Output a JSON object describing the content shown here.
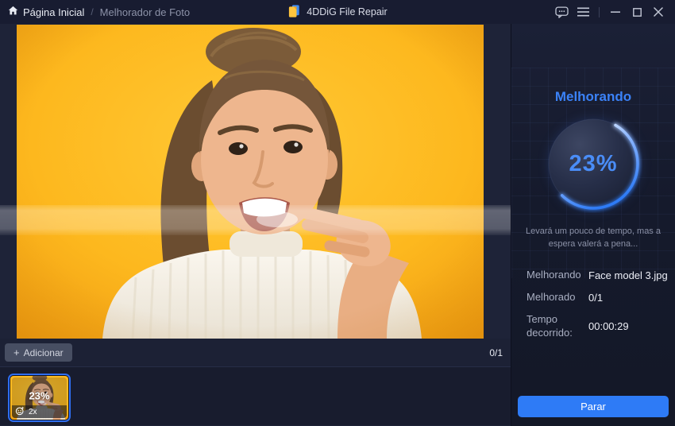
{
  "titlebar": {
    "breadcrumb": {
      "home_label": "Página Inicial",
      "separator": "/",
      "current_label": "Melhorador de Foto"
    },
    "app_title": "4DDiG File Repair"
  },
  "workspace": {
    "add_plus": "+",
    "add_label": "Adicionar",
    "counter": "0/1",
    "thumbnail": {
      "percent_label": "23%",
      "zoom_label": "2x",
      "selected": true
    }
  },
  "progress": {
    "title": "Melhorando",
    "percent_label": "23%",
    "percent_value": 23,
    "caption": "Levará um pouco de tempo, mas a espera valerá a pena...",
    "details": [
      {
        "label": "Melhorando",
        "value": "Face model 3.jpg"
      },
      {
        "label": "Melhorado",
        "value": "0/1"
      },
      {
        "label": "Tempo decorrido:",
        "value": "00:00:29"
      }
    ],
    "stop_label": "Parar"
  },
  "icons": {
    "home": "home-icon",
    "app_logo": "app-logo-icon",
    "feedback": "feedback-bubble-icon",
    "menu": "hamburger-menu-icon",
    "minimize": "minimize-icon",
    "maximize": "maximize-icon",
    "close": "close-icon",
    "add_plus": "plus-icon",
    "face_enhance": "face-smiley-icon"
  },
  "colors": {
    "accent_blue": "#2e7bf6",
    "heading_blue": "#3b82f7",
    "progress_text": "#4a8df7",
    "photo_yellow": "#fdb81e"
  }
}
